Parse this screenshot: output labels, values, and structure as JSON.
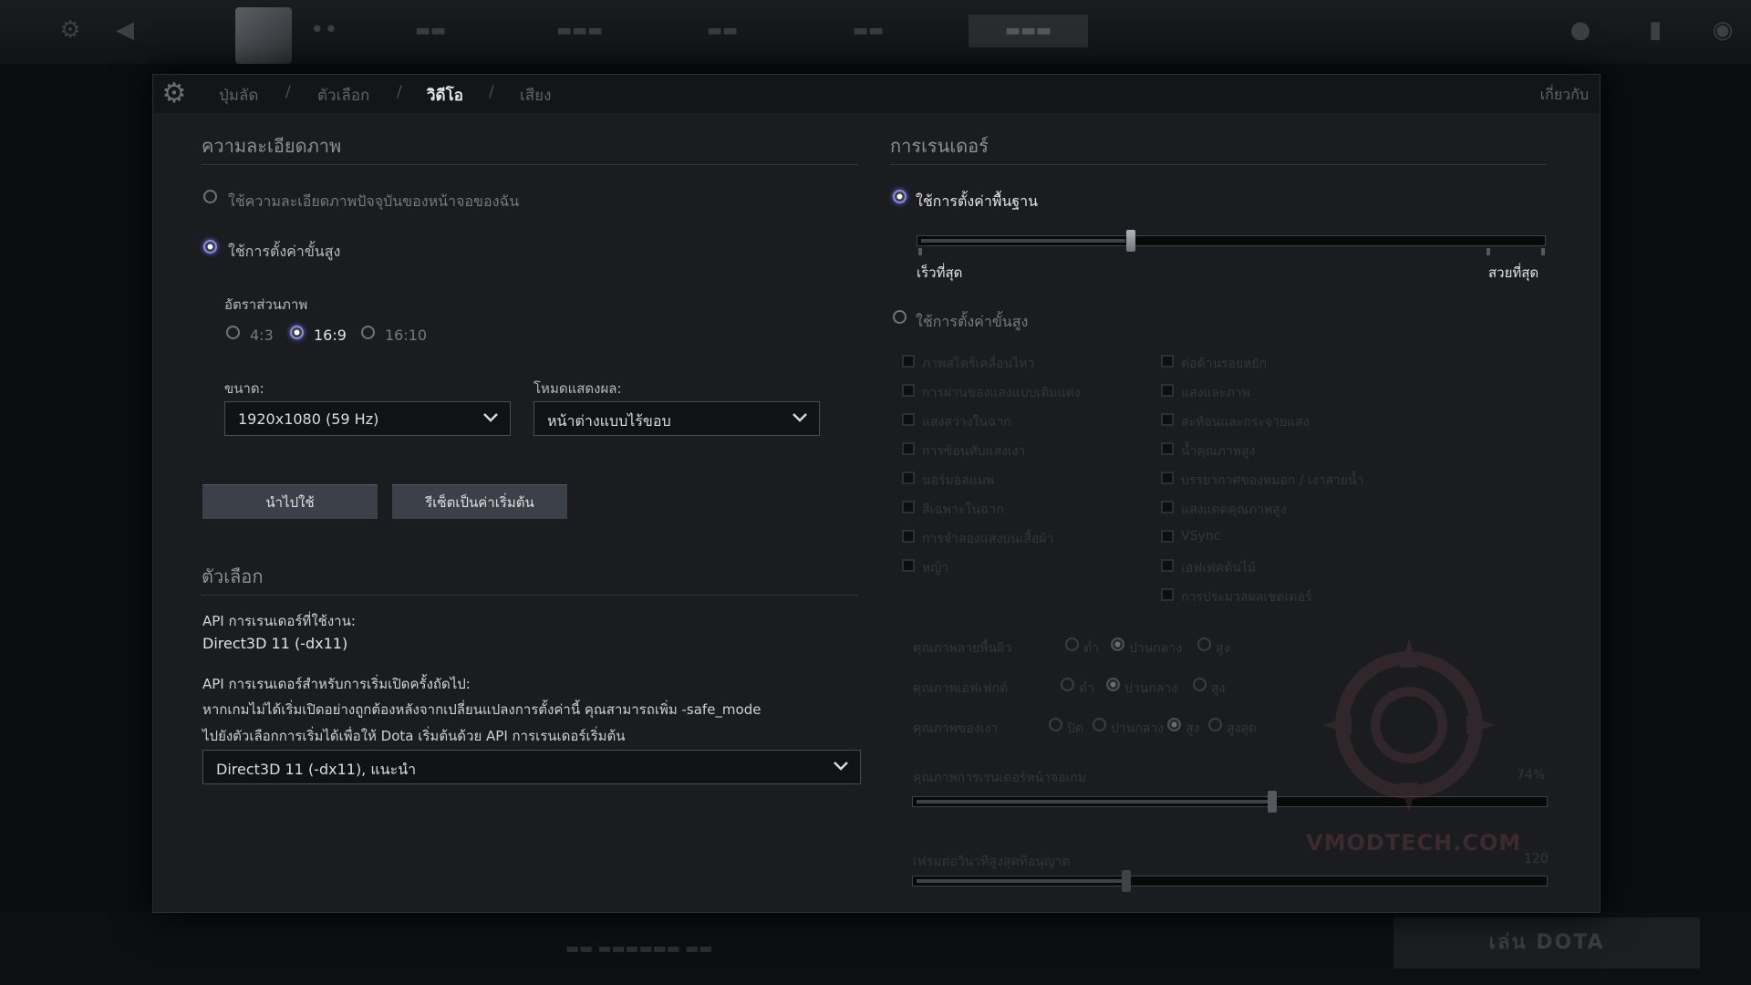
{
  "header": {
    "breadcrumbs": [
      "ปุ่มลัด",
      "ตัวเลือก",
      "วิดีโอ",
      "เสียง"
    ],
    "active_breadcrumb": "วิดีโอ",
    "about_label": "เกี่ยวกับ"
  },
  "resolution": {
    "title": "ความละเอียดภาพ",
    "use_current_label": "ใช้ความละเอียดภาพปัจจุบันของหน้าจอของฉัน",
    "use_advanced_label": "ใช้การตั้งค่าขั้นสูง",
    "aspect_label": "อัตราส่วนภาพ",
    "aspect_options": [
      "4:3",
      "16:9",
      "16:10"
    ],
    "aspect_selected": "16:9",
    "size_label": "ขนาด:",
    "size_value": "1920x1080 (59 Hz)",
    "display_mode_label": "โหมดแสดงผล:",
    "display_mode_value": "หน้าต่างแบบไร้ขอบ",
    "apply_label": "นำไปใช้",
    "reset_label": "รีเซ็ตเป็นค่าเริ่มต้น"
  },
  "options": {
    "title": "ตัวเลือก",
    "api_current_label": "API การเรนเดอร์ที่ใช้งาน:",
    "api_current_value": "Direct3D 11 (-dx11)",
    "api_next_label": "API การเรนเดอร์สำหรับการเริ่มเปิดครั้งถัดไป:",
    "api_note_line1": "หากเกมไม่ได้เริ่มเปิดอย่างถูกต้องหลังจากเปลี่ยนแปลงการตั้งค่านี้ คุณสามารถเพิ่ม -safe_mode",
    "api_note_line2": "ไปยังตัวเลือกการเริ่มได้เพื่อให้ Dota เริ่มต้นด้วย API การเรนเดอร์เริ่มต้น",
    "api_select_value": "Direct3D 11 (-dx11), แนะนำ"
  },
  "rendering": {
    "title": "การเรนเดอร์",
    "basic_label": "ใช้การตั้งค่าพื้นฐาน",
    "quality_slider_level": 0.34,
    "fastest_label": "เร็วที่สุด",
    "prettiest_label": "สวยที่สุด",
    "advanced_label": "ใช้การตั้งค่าขั้นสูง",
    "checks_left": [
      "ภาพสไตร์เคลื่อนไหว",
      "การผ่านของแสงแบบเติมแต่ง",
      "แสงสว่างในฉาก",
      "การซ้อนทับแสงเงา",
      "นอร์มอลแมพ",
      "สีเฉพาะในฉาก",
      "การจำลองแสงบนเสื้อผ้า",
      "หญ้า"
    ],
    "checks_right": [
      "ต่อต้านรอยหยัก",
      "แสงและภาพ",
      "สะท้อนและกระจายแสง",
      "น้ำคุณภาพสูง",
      "บรรยากาศของหมอก / เงาสายน้ำ",
      "แสงแดดคุณภาพสูง",
      "VSync",
      "เอฟเฟคต้นไม้",
      "การประมวลผลเชดเดอร์"
    ],
    "texture_quality_label": "คุณภาพลายพื้นผิว",
    "texture_options": [
      "ต่ำ",
      "ปานกลาง",
      "สูง"
    ],
    "texture_selected": "ปานกลาง",
    "effects_quality_label": "คุณภาพเอฟเฟกต์",
    "effects_options": [
      "ต่ำ",
      "ปานกลาง",
      "สูง"
    ],
    "effects_selected": "ปานกลาง",
    "shadow_quality_label": "คุณภาพของเงา",
    "shadow_options": [
      "ปิด",
      "ปานกลาง",
      "สูง",
      "สูงสุด"
    ],
    "shadow_selected": "สูง",
    "render_quality_label": "คุณภาพการเรนเดอร์หน้าจอเกม",
    "render_quality_value": "74%",
    "render_quality_level": 0.57,
    "max_fps_label": "เฟรมต่อวินาทีสูงสุดที่อนุญาต",
    "max_fps_value": "120",
    "max_fps_level": 0.34
  },
  "bottom": {
    "play_label": "เล่น DOTA"
  },
  "watermark": {
    "text": "VMODTECH.COM"
  },
  "colors": {
    "accent": "#8b8fd8",
    "panel_bg": "#1b1c1f"
  }
}
